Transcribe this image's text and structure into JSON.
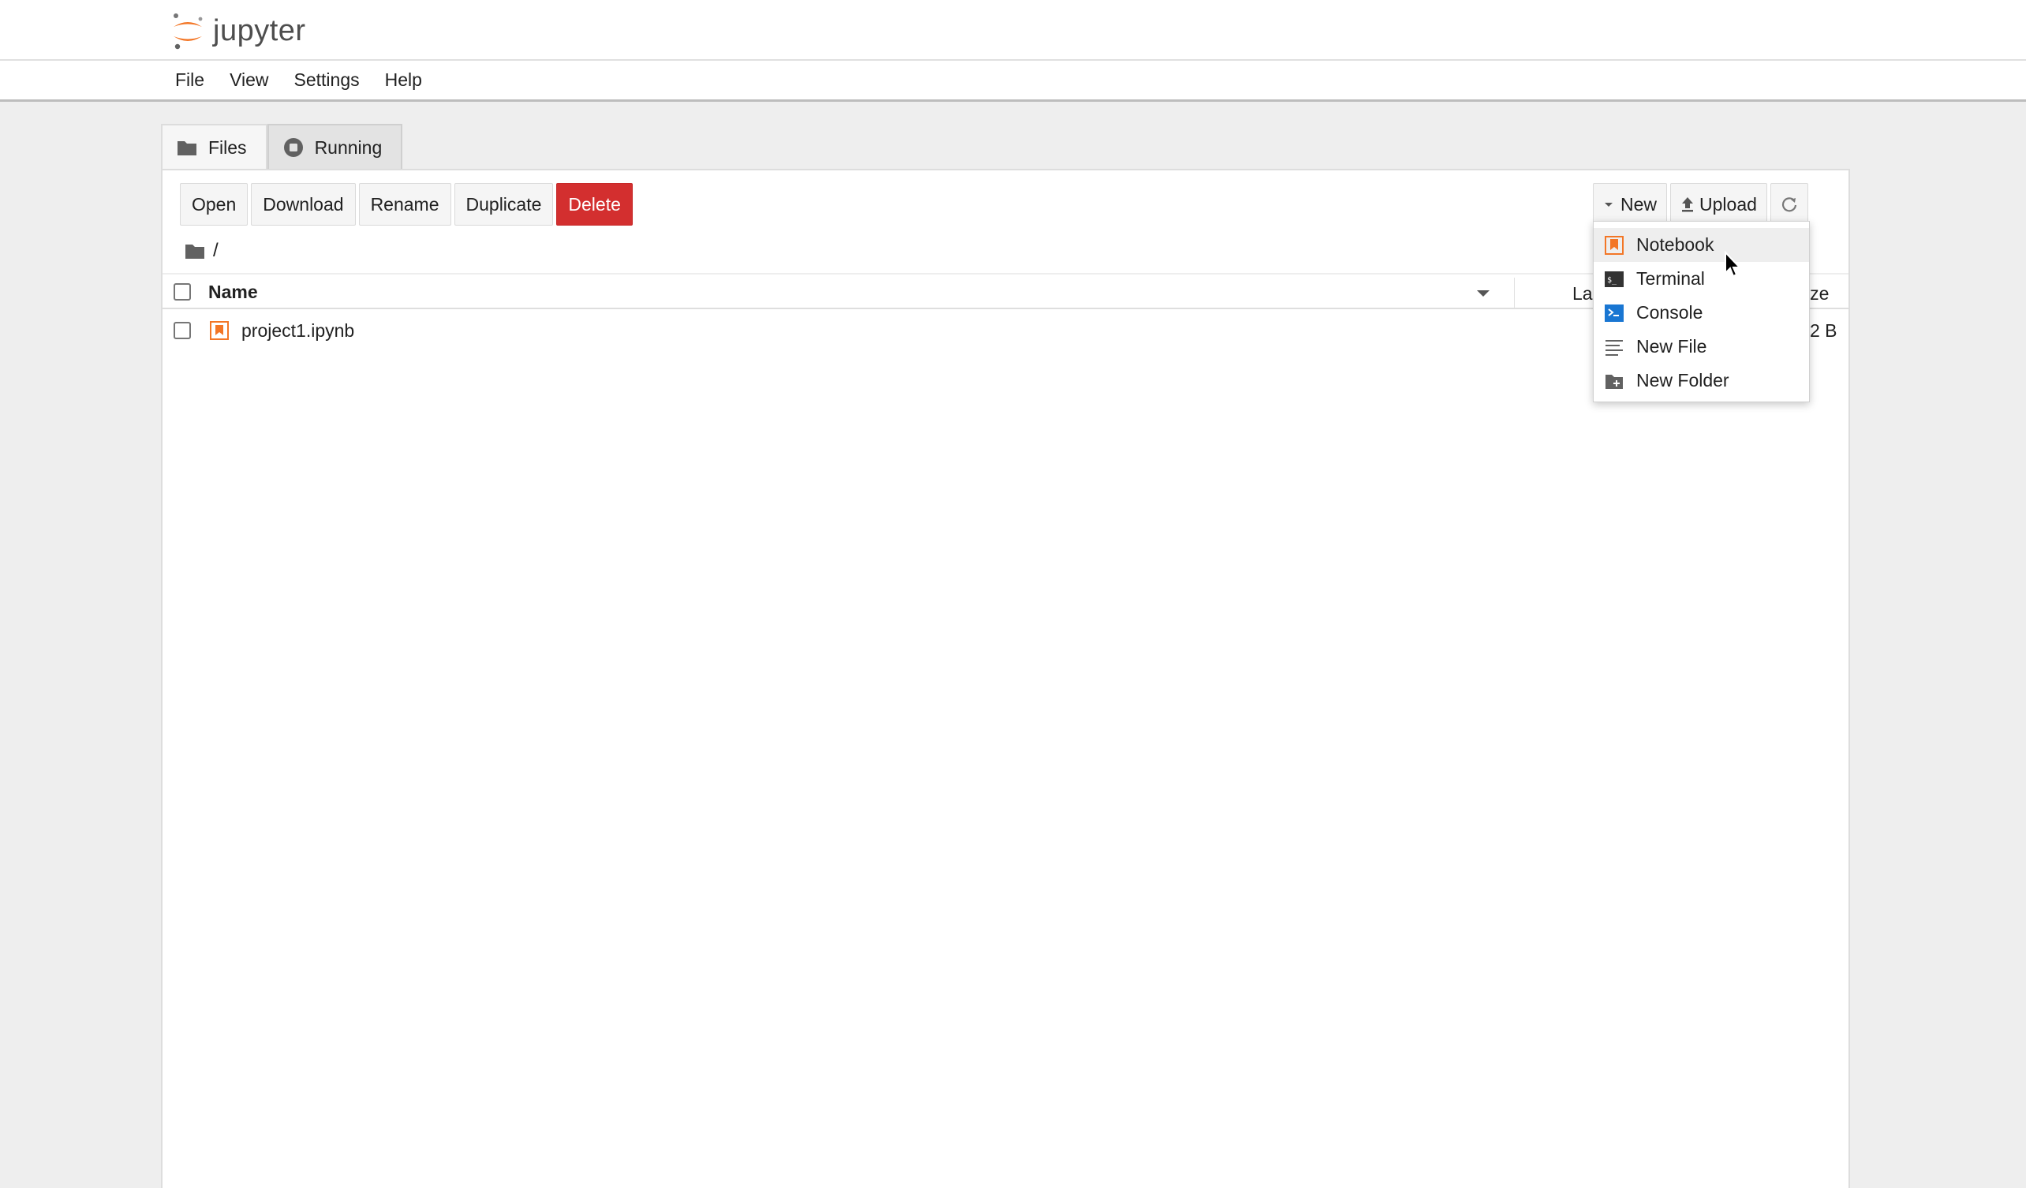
{
  "header": {
    "logo_text": "jupyter"
  },
  "menu": [
    "File",
    "View",
    "Settings",
    "Help"
  ],
  "tabs": [
    {
      "label": "Files",
      "icon": "folder-icon",
      "active": true
    },
    {
      "label": "Running",
      "icon": "stop-circle-icon",
      "active": false
    }
  ],
  "toolbar": {
    "open": "Open",
    "download": "Download",
    "rename": "Rename",
    "duplicate": "Duplicate",
    "delete": "Delete",
    "new": "New",
    "upload": "Upload"
  },
  "breadcrumb": {
    "path": "/"
  },
  "list": {
    "headers": {
      "name": "Name",
      "modified": "La",
      "size": "ize"
    },
    "rows": [
      {
        "name": "project1.ipynb",
        "size": "2 B",
        "icon": "notebook-icon"
      }
    ]
  },
  "new_menu": {
    "items": [
      {
        "label": "Notebook",
        "icon": "notebook-icon"
      },
      {
        "label": "Terminal",
        "icon": "terminal-icon"
      },
      {
        "label": "Console",
        "icon": "console-icon"
      },
      {
        "label": "New File",
        "icon": "text-file-icon"
      },
      {
        "label": "New Folder",
        "icon": "new-folder-icon"
      }
    ],
    "highlighted": "Notebook"
  },
  "colors": {
    "accent": "#f37626",
    "danger": "#d32f2f",
    "console_blue": "#1976d2"
  }
}
